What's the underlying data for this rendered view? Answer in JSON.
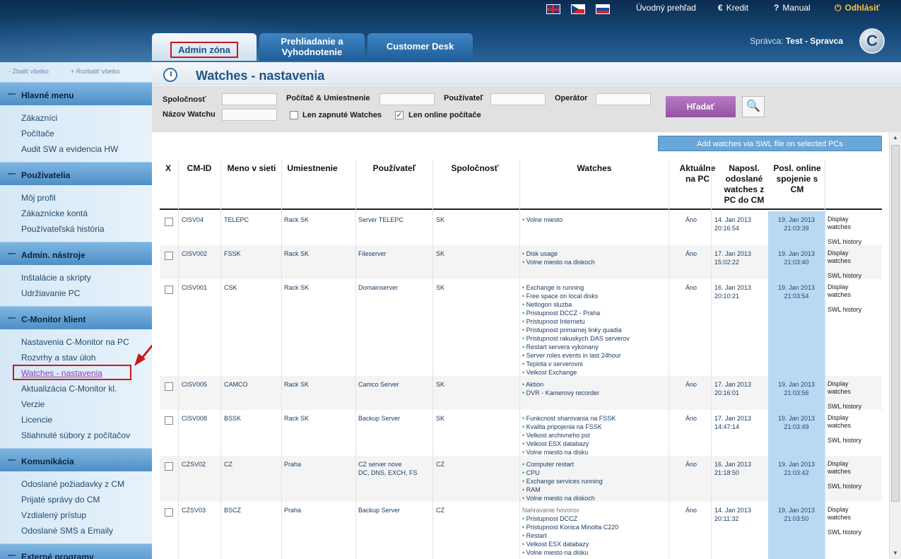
{
  "header": {
    "overview": "Úvodný prehľad",
    "credit": "Kredit",
    "manual": "Manual",
    "logout": "Odhlásiť",
    "manager_label": "Správca:",
    "manager_name": "Test - Spravca",
    "logo_letter": "C"
  },
  "tabs": [
    {
      "label": "Admin zóna",
      "active": true
    },
    {
      "label_line1": "Prehliadanie a",
      "label_line2": "Vyhodnotenie"
    },
    {
      "label": "Customer Desk"
    }
  ],
  "sidebar": {
    "collapse_all": "- Zbaliť všetko",
    "expand_all": "+ Rozbaliť všetko",
    "sections": [
      {
        "title": "Hlavné menu",
        "items": [
          "Zákazníci",
          "Počítače",
          "Audit SW a evidencia HW"
        ]
      },
      {
        "title": "Používatelia",
        "items": [
          "Môj profil",
          "Zákaznícke kontá",
          "Používateľská história"
        ]
      },
      {
        "title": "Admin. nástroje",
        "items": [
          "Inštalácie a skripty",
          "Udržiavanie PC"
        ]
      },
      {
        "title": "C-Monitor klient",
        "items": [
          "Nastavenia C-Monitor na PC",
          "Rozvrhy a stav úloh",
          "Watches - nastavenia",
          "Aktualizácia C-Monitor kl.",
          "Verzie",
          "Licencie",
          "Stiahnuté súbory z počítačov"
        ]
      },
      {
        "title": "Komunikácia",
        "items": [
          "Odoslané požiadavky z CM",
          "Prijaté správy do CM",
          "Vzdialený prístup",
          "Odoslané SMS a Emaily"
        ]
      },
      {
        "title": "Externé programy",
        "items": []
      }
    ]
  },
  "page": {
    "title": "Watches - nastavenia"
  },
  "filters": {
    "company": "Spoločnosť",
    "computer_location": "Počítač & Umiestnenie",
    "user": "Používateľ",
    "operator": "Operátor",
    "watch_name": "Názov Watchu",
    "only_enabled": "Len zapnuté Watches",
    "only_online": "Len online počítače",
    "search": "Hľadať"
  },
  "add_swl": "Add watches via SWL file on selected PCs",
  "table": {
    "headers": {
      "x": "X",
      "cmid": "CM-ID",
      "netname": "Meno v sieti",
      "location": "Umiestnenie",
      "user": "Používateľ",
      "company": "Spoločnosť",
      "watches": "Watches",
      "current_l1": "Aktuálne",
      "current_l2": "na PC",
      "sent_l1": "Naposl.",
      "sent_l2": "odoslané",
      "sent_l3": "watches z",
      "sent_l4": "PC do CM",
      "online_l1": "Posl. online",
      "online_l2": "spojenie s",
      "online_l3": "CM"
    },
    "actions": {
      "display_l1": "Display",
      "display_l2": "watches",
      "swl": "SWL history"
    },
    "rows": [
      {
        "cmid": "CISV04",
        "netname": "TELEPC",
        "location": "Rack SK",
        "user_l1": "Server TELEPC",
        "user_l2": "",
        "company": "SK",
        "watches": [
          "Volne miesto"
        ],
        "current": "Áno",
        "sent_date": "14. Jan 2013",
        "sent_time": "20:16:54",
        "online_date": "19. Jan 2013",
        "online_time": "21:03:39"
      },
      {
        "cmid": "CISV002",
        "netname": "FSSK",
        "location": "Rack SK",
        "user_l1": "Fileserver",
        "user_l2": "",
        "company": "SK",
        "watches": [
          "Disk usage",
          "Volne miesto na diskoch"
        ],
        "current": "Áno",
        "sent_date": "17. Jan 2013",
        "sent_time": "15:02:22",
        "online_date": "19. Jan 2013",
        "online_time": "21:03:40"
      },
      {
        "cmid": "CISV001",
        "netname": "CSK",
        "location": "Rack SK",
        "user_l1": "Domainserver",
        "user_l2": "",
        "company": "SK",
        "watches": [
          "Exchange is running",
          "Free space on local disks",
          "Netlogon sluzba",
          "Pristupnost DCCZ - Praha",
          "Pristupnost Internetu",
          "Pristupnost primarnej linky quadia",
          "Pristupnost rakuskych DAS serverov",
          "Restart servera vykonany",
          "Server roles events in last 24hour",
          "Teplota v serverovni",
          "Velkost Exchange"
        ],
        "current": "Áno",
        "sent_date": "16. Jan 2013",
        "sent_time": "20:10:21",
        "online_date": "19. Jan 2013",
        "online_time": "21:03:54"
      },
      {
        "cmid": "CISV005",
        "netname": "CAMCO",
        "location": "Rack SK",
        "user_l1": "Camco Server",
        "user_l2": "",
        "company": "SK",
        "watches": [
          "Aktion",
          "DVR - Kamerovy recorder"
        ],
        "current": "Áno",
        "sent_date": "17. Jan 2013",
        "sent_time": "20:16:01",
        "online_date": "19. Jan 2013",
        "online_time": "21:03:56"
      },
      {
        "cmid": "CISV008",
        "netname": "BSSK",
        "location": "Rack SK",
        "user_l1": "Backup Server",
        "user_l2": "",
        "company": "SK",
        "watches": [
          "Funkcnost sharovania na FSSK",
          "Kvalita pripojenia na FSSK",
          "Velkost archivneho pst",
          "Velkost ESX databazy",
          "Volne miesto na disku"
        ],
        "current": "Áno",
        "sent_date": "17. Jan 2013",
        "sent_time": "14:47:14",
        "online_date": "19. Jan 2013",
        "online_time": "21:03:49"
      },
      {
        "cmid": "CZSV02",
        "netname": "CZ",
        "location": "Praha",
        "user_l1": "CZ server nove",
        "user_l2": "DC, DNS, EXCH, FS",
        "company": "CZ",
        "watches": [
          "Computer restart",
          "CPU",
          "Exchange services running",
          "RAM",
          "Volne miesto na diskoch"
        ],
        "current": "Áno",
        "sent_date": "16. Jan 2013",
        "sent_time": "21:18:50",
        "online_date": "19. Jan 2013",
        "online_time": "21:03:42"
      },
      {
        "cmid": "CZSV03",
        "netname": "BSCZ",
        "location": "Praha",
        "user_l1": "Backup Server",
        "user_l2": "",
        "company": "CZ",
        "watches": [
          "Nahravanie hovorov",
          "Pristupnost DCCZ",
          "Pristupnost Konica Minolta C220",
          "Restart",
          "Velkost ESX databazy",
          "Volne miesto na disku"
        ],
        "current": "Áno",
        "sent_date": "14. Jan 2013",
        "sent_time": "20:11:32",
        "online_date": "19. Jan 2013",
        "online_time": "21:03:50"
      }
    ]
  }
}
